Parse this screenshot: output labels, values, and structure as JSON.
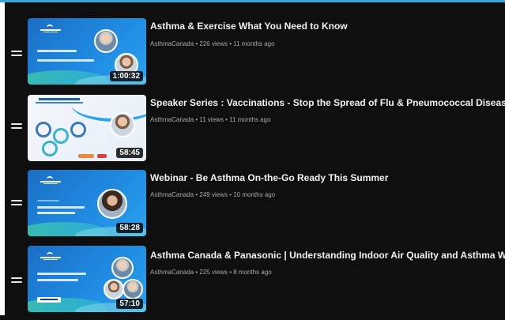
{
  "videos": [
    {
      "title": "Asthma & Exercise What You Need to Know",
      "channel": "AsthmaCanada",
      "views": "226 views",
      "age": "11 months ago",
      "duration": "1:00:32"
    },
    {
      "title": "Speaker Series : Vaccinations - Stop the Spread of Flu & Pneumococcal Disease",
      "channel": "AsthmaCanada",
      "views": "11 views",
      "age": "11 months ago",
      "duration": "58:45"
    },
    {
      "title": "Webinar - Be Asthma On-the-Go Ready This Summer",
      "channel": "AsthmaCanada",
      "views": "249 views",
      "age": "10 months ago",
      "duration": "58:28"
    },
    {
      "title": "Asthma Canada & Panasonic | Understanding Indoor Air Quality and Asthma Webinar",
      "channel": "AsthmaCanada",
      "views": "225 views",
      "age": "8 months ago",
      "duration": "57:10"
    }
  ],
  "meta_separator": " • ",
  "colors": {
    "background": "#0f0f0f",
    "title": "#f1f1f1",
    "meta": "#aaaaaa",
    "accent_rule": "#3aa7d8",
    "thumbnail_blue": "#1f8ae0"
  },
  "icons": {
    "drag_handle": "drag-handle-icon"
  }
}
